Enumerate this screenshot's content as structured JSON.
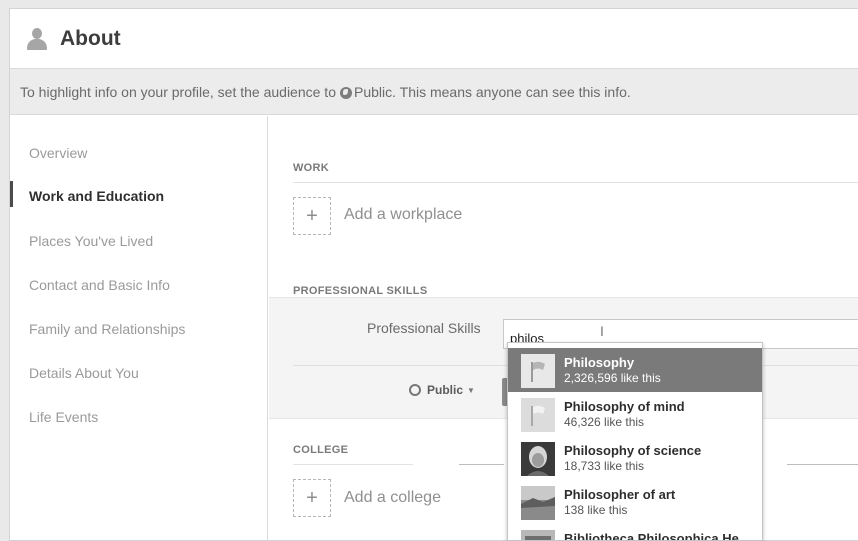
{
  "header": {
    "title": "About"
  },
  "banner": {
    "text_before": "To highlight info on your profile, set the audience to ",
    "text_after": "Public. This means anyone can see this info."
  },
  "sidebar": {
    "items": [
      {
        "label": "Overview"
      },
      {
        "label": "Work and Education"
      },
      {
        "label": "Places You've Lived"
      },
      {
        "label": "Contact and Basic Info"
      },
      {
        "label": "Family and Relationships"
      },
      {
        "label": "Details About You"
      },
      {
        "label": "Life Events"
      }
    ],
    "active_label": "Work and Education"
  },
  "work": {
    "section_title": "WORK",
    "add_label": "Add a workplace",
    "add_symbol": "+"
  },
  "skills": {
    "section_title": "PROFESSIONAL SKILLS",
    "field_label": "Professional Skills",
    "input_value": "philos",
    "privacy_label": "Public",
    "privacy_caret": "▼"
  },
  "college": {
    "section_title": "COLLEGE",
    "add_label": "Add a college",
    "add_symbol": "+"
  },
  "suggestions": [
    {
      "name": "Philosophy",
      "likes": "2,326,596 like this",
      "icon": "flag-icon",
      "selected": true
    },
    {
      "name": "Philosophy of mind",
      "likes": "46,326 like this",
      "icon": "flag-icon",
      "selected": false
    },
    {
      "name": "Philosophy of science",
      "likes": "18,733 like this",
      "icon": "portrait-photo",
      "selected": false
    },
    {
      "name": "Philosopher of art",
      "likes": "138 like this",
      "icon": "landscape-photo",
      "selected": false
    },
    {
      "name": "Bibliotheca Philosophica He…",
      "likes": "",
      "icon": "building-photo",
      "selected": false
    }
  ],
  "colors": {
    "selected_row": "#7a7a7a",
    "panel_bg": "#ffffff",
    "page_bg": "#e9e9e9"
  }
}
